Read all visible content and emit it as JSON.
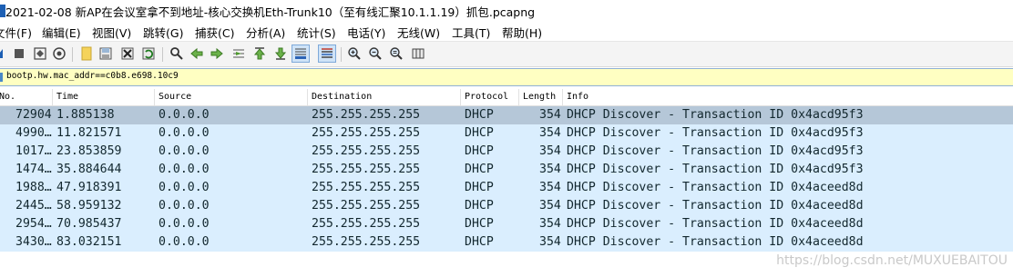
{
  "window": {
    "title": "2021-02-08 新AP在会议室拿不到地址-核心交换机Eth-Trunk10（至有线汇聚10.1.1.19）抓包.pcapng"
  },
  "menu": [
    "文件(F)",
    "编辑(E)",
    "视图(V)",
    "跳转(G)",
    "捕获(C)",
    "分析(A)",
    "统计(S)",
    "电话(Y)",
    "无线(W)",
    "工具(T)",
    "帮助(H)"
  ],
  "toolbar": {
    "icons": [
      "shark-fin-icon",
      "stop-icon",
      "restart-icon",
      "options-gear-icon",
      "open-file-icon",
      "save-icon",
      "close-file-icon",
      "reload-icon",
      "find-icon",
      "back-icon",
      "forward-icon",
      "goto-packet-icon",
      "first-packet-icon",
      "last-packet-icon",
      "autoscroll-icon",
      "colorize-icon",
      "zoom-in-icon",
      "zoom-out-icon",
      "zoom-normal-icon",
      "resize-columns-icon"
    ]
  },
  "filter": {
    "value": "bootp.hw.mac_addr==c0b8.e698.10c9"
  },
  "columns": [
    "No.",
    "Time",
    "Source",
    "Destination",
    "Protocol",
    "Length",
    "Info"
  ],
  "packets": [
    {
      "no": "72904",
      "time": "1.885138",
      "source": "0.0.0.0",
      "destination": "255.255.255.255",
      "protocol": "DHCP",
      "length": "354",
      "info": "DHCP Discover - Transaction ID 0x4acd95f3"
    },
    {
      "no": "4990…",
      "time": "11.821571",
      "source": "0.0.0.0",
      "destination": "255.255.255.255",
      "protocol": "DHCP",
      "length": "354",
      "info": "DHCP Discover - Transaction ID 0x4acd95f3"
    },
    {
      "no": "1017…",
      "time": "23.853859",
      "source": "0.0.0.0",
      "destination": "255.255.255.255",
      "protocol": "DHCP",
      "length": "354",
      "info": "DHCP Discover - Transaction ID 0x4acd95f3"
    },
    {
      "no": "1474…",
      "time": "35.884644",
      "source": "0.0.0.0",
      "destination": "255.255.255.255",
      "protocol": "DHCP",
      "length": "354",
      "info": "DHCP Discover - Transaction ID 0x4acd95f3"
    },
    {
      "no": "1988…",
      "time": "47.918391",
      "source": "0.0.0.0",
      "destination": "255.255.255.255",
      "protocol": "DHCP",
      "length": "354",
      "info": "DHCP Discover - Transaction ID 0x4aceed8d"
    },
    {
      "no": "2445…",
      "time": "58.959132",
      "source": "0.0.0.0",
      "destination": "255.255.255.255",
      "protocol": "DHCP",
      "length": "354",
      "info": "DHCP Discover - Transaction ID 0x4aceed8d"
    },
    {
      "no": "2954…",
      "time": "70.985437",
      "source": "0.0.0.0",
      "destination": "255.255.255.255",
      "protocol": "DHCP",
      "length": "354",
      "info": "DHCP Discover - Transaction ID 0x4aceed8d"
    },
    {
      "no": "3430…",
      "time": "83.032151",
      "source": "0.0.0.0",
      "destination": "255.255.255.255",
      "protocol": "DHCP",
      "length": "354",
      "info": "DHCP Discover - Transaction ID 0x4aceed8d"
    }
  ],
  "selected_row": 0,
  "watermark": "https://blog.csdn.net/MUXUEBAITOU",
  "colors": {
    "selected_row": "#b5c7d8",
    "udp_row": "#daeefe",
    "filter_ok": "#ffffc2",
    "toolbar_bg": "#f4f4f4"
  }
}
